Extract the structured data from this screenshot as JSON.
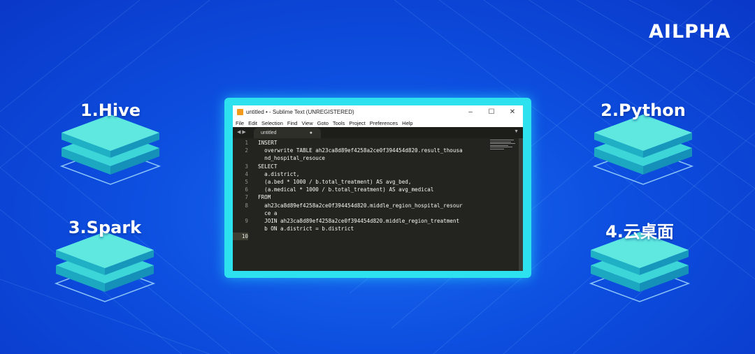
{
  "brand": {
    "logo": "AILPHA"
  },
  "techs": [
    {
      "label": "1.Hive"
    },
    {
      "label": "2.Python"
    },
    {
      "label": "3.Spark"
    },
    {
      "label": "4.云桌面"
    }
  ],
  "window": {
    "title": "untitled • - Sublime Text (UNREGISTERED)",
    "controls": [
      "–",
      "☐",
      "✕"
    ],
    "menu": [
      "File",
      "Edit",
      "Selection",
      "Find",
      "View",
      "Goto",
      "Tools",
      "Project",
      "Preferences",
      "Help"
    ],
    "tab_nav": "◀ ▶",
    "tab": {
      "label": "untitled",
      "dirty": "●"
    },
    "tab_arrow": "▼",
    "lines": [
      {
        "num": "1",
        "text": "INSERT"
      },
      {
        "num": "2",
        "text": "  overwrite TABLE ah23ca8d89ef4258a2ce0f394454d820.result_thousa"
      },
      {
        "num": "",
        "text": "  nd_hospital_resouce"
      },
      {
        "num": "3",
        "text": "SELECT"
      },
      {
        "num": "4",
        "text": "  a.district,"
      },
      {
        "num": "5",
        "text": "  (a.bed * 1000 / b.total_treatment) AS avg_bed,"
      },
      {
        "num": "6",
        "text": "  (a.medical * 1000 / b.total_treatment) AS avg_medical"
      },
      {
        "num": "7",
        "text": "FROM"
      },
      {
        "num": "8",
        "text": "  ah23ca8d89ef4258a2ce0f394454d820.middle_region_hospital_resour"
      },
      {
        "num": "",
        "text": "  ce a"
      },
      {
        "num": "9",
        "text": "  JOIN ah23ca8d89ef4258a2ce0f394454d820.middle_region_treatment"
      },
      {
        "num": "",
        "text": "  b ON a.district = b.district"
      },
      {
        "num": "10",
        "text": ""
      }
    ]
  }
}
